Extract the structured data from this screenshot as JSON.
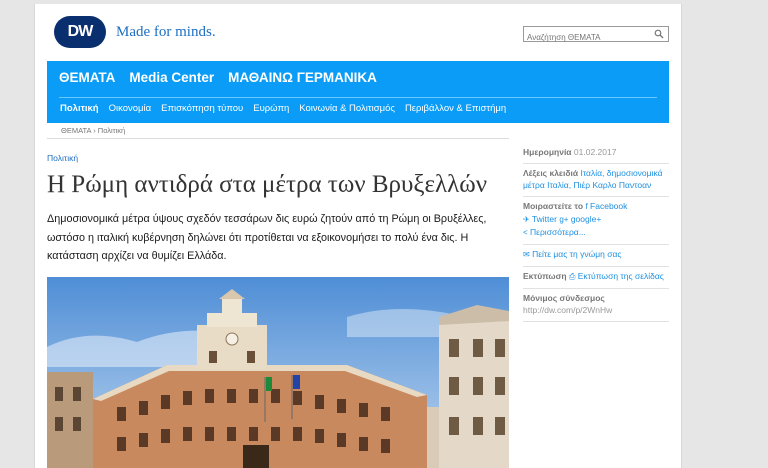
{
  "header": {
    "logo": "DW",
    "tagline": "Made for minds.",
    "search_placeholder": "Αναζήτηση ΘΕΜΑΤΑ"
  },
  "nav": {
    "main": [
      "ΘΕΜΑΤΑ",
      "Media Center",
      "ΜΑΘΑΙΝΩ ΓΕΡΜΑΝΙΚΑ"
    ],
    "sub": [
      "Πολιτική",
      "Οικονομία",
      "Επισκόπηση τύπου",
      "Ευρώπη",
      "Κοινωνία & Πολιτισμός",
      "Περιβάλλον & Επιστήμη"
    ]
  },
  "breadcrumb": "ΘΕΜΑΤΑ › Πολιτική",
  "article": {
    "section": "Πολιτική",
    "title": "Η Ρώμη αντιδρά στα μέτρα των Βρυξελλών",
    "lead": "Δημοσιονομικά μέτρα ύψους σχεδόν τεσσάρων δις ευρώ ζητούν από τη Ρώμη οι Βρυξέλλες, ωστόσο η ιταλική κυβέρνηση δηλώνει ότι προτίθεται να εξοικονομήσει το πολύ ένα δις. Η κατάσταση αρχίζει να θυμίζει Ελλάδα."
  },
  "sidebar": {
    "date_label": "Ημερομηνία",
    "date_value": "01.02.2017",
    "keywords_label": "Λέξεις κλειδιά",
    "keywords_value": "Ιταλία, δημοσιονομικά μέτρα Ιταλία, Πιέρ Καρλο Παντοαν",
    "share_label": "Μοιραστείτε το",
    "facebook": "Facebook",
    "twitter": "Twitter",
    "googleplus": "google+",
    "more": "Περισσότερα...",
    "feedback": "Πείτε μας τη γνώμη σας",
    "print_label": "Εκτύπωση",
    "print_link": "Εκτύπωση της σελίδας",
    "permalink_label": "Μόνιμος σύνδεσμος",
    "permalink_value": "http://dw.com/p/2WnHw"
  }
}
